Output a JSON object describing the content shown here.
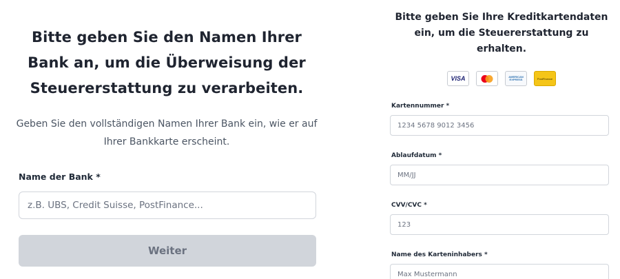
{
  "bank_form": {
    "heading": "Bitte geben Sie den Namen Ihrer Bank an, um die Überweisung der Steuererstattung zu verarbeiten.",
    "description": "Geben Sie den vollständigen Namen Ihrer Bank ein, wie er auf Ihrer Bankkarte erscheint.",
    "bank_name_label": "Name der Bank *",
    "bank_name_placeholder": "z.B. UBS, Credit Suisse, PostFinance...",
    "bank_name_value": "",
    "continue_button": "Weiter"
  },
  "card_form": {
    "heading": "Bitte geben Sie Ihre Kreditkartendaten ein, um die Steuererstattung zu erhalten.",
    "card_logos": [
      {
        "name": "visa-icon",
        "text": "VISA"
      },
      {
        "name": "mastercard-icon",
        "text": ""
      },
      {
        "name": "american-express-icon",
        "text": "AMERICAN EXPRESS"
      },
      {
        "name": "postfinance-icon",
        "text": "PostFinance"
      }
    ],
    "card_number_label": "Kartennummer *",
    "card_number_placeholder": "1234 5678 9012 3456",
    "expiry_label": "Ablaufdatum *",
    "expiry_placeholder": "MM/JJ",
    "cvv_label": "CVV/CVC *",
    "cvv_placeholder": "123",
    "holder_label": "Name des Karteninhabers *",
    "holder_placeholder": "Max Mustermann"
  },
  "colors": {
    "button_disabled_bg": "#d1d5db",
    "button_disabled_text": "#6b7280",
    "mastercard_red": "#eb001b",
    "mastercard_orange": "#f79e1b",
    "visa_blue": "#1a1f71",
    "postfinance_yellow": "#f5c518"
  }
}
